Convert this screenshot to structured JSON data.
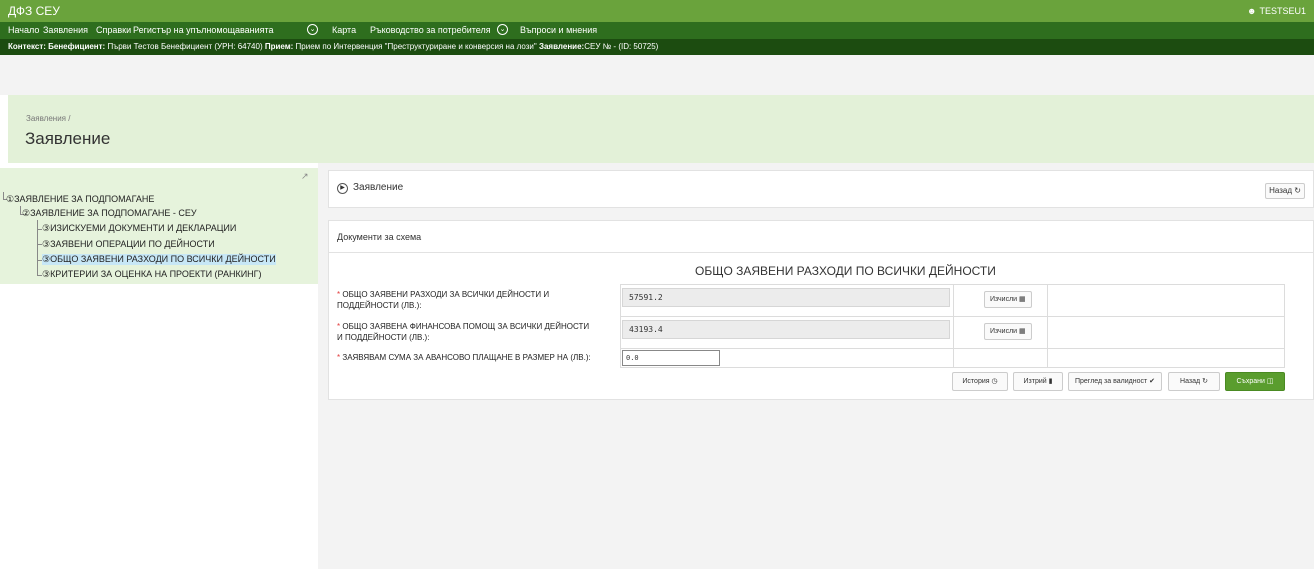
{
  "topbar": {
    "title": "ДФЗ СЕУ",
    "user_icon": "user-icon",
    "user": "TESTSEU1"
  },
  "menu": {
    "items": [
      "Начало",
      "Заявления",
      "Справки",
      "Регистър на упълномощаванията",
      "Карта",
      "Ръководство за потребителя",
      "Въпроси и мнения"
    ],
    "chevron_icon": "chevron-down-icon"
  },
  "context": {
    "label1": "Контекст: Бенефициент:",
    "text1": " Първи Тестов Бенефициент (УРН: 64740) ",
    "label2": "Прием:",
    "text2": " Прием по Интервенция \"Преструктуриране и конверсия на лози\" ",
    "label3": "Заявление:",
    "text3": "СЕУ № - (ID: 50725)"
  },
  "page": {
    "breadcrumb": "Заявления /",
    "title": "Заявление"
  },
  "tree": {
    "expand_icon": "expand-icon",
    "nodes": [
      "①ЗАЯВЛЕНИЕ ЗА ПОДПОМАГАНЕ",
      "②ЗАЯВЛЕНИЕ ЗА ПОДПОМАГАНЕ - СЕУ",
      "③ИЗИСКУЕМИ ДОКУМЕНТИ И ДЕКЛАРАЦИИ",
      "③ЗАЯВЕНИ ОПЕРАЦИИ ПО ДЕЙНОСТИ",
      "③ОБЩО ЗАЯВЕНИ РАЗХОДИ ПО ВСИЧКИ ДЕЙНОСТИ",
      "③КРИТЕРИИ ЗА ОЦЕНКА НА ПРОЕКТИ (РАНКИНГ)"
    ],
    "selected_index": 4
  },
  "panel": {
    "title": "Заявление",
    "back_label": "Назад",
    "play_icon": "play-icon",
    "refresh_icon": "refresh-icon"
  },
  "docs": {
    "label": "Документи за схема",
    "section_title": "ОБЩО ЗАЯВЕНИ РАЗХОДИ ПО ВСИЧКИ ДЕЙНОСТИ",
    "required_mark": "*",
    "rows": [
      {
        "label_line1": "ОБЩО ЗАЯВЕНИ РАЗХОДИ ЗА ВСИЧКИ ДЕЙНОСТИ И",
        "label_line2": "ПОДДЕЙНОСТИ (ЛВ.):",
        "value": "57591.2",
        "button": "Изчисли"
      },
      {
        "label_line1": "ОБЩО ЗАЯВЕНА ФИНАНСОВА ПОМОЩ ЗА ВСИЧКИ ДЕЙНОСТИ",
        "label_line2": "И ПОДДЕЙНОСТИ (ЛВ.):",
        "value": "43193.4",
        "button": "Изчисли"
      },
      {
        "label_line1": "ЗАЯВЯВАМ СУМА ЗА АВАНСОВО ПЛАЩАНЕ В РАЗМЕР НА (ЛВ.):",
        "value": "0.0"
      }
    ],
    "calc_icon": "calculator-icon"
  },
  "actions": {
    "history": "История",
    "delete": "Изтрий",
    "validate": "Преглед за валидност",
    "back": "Назад",
    "save": "Съхрани",
    "history_icon": "clock-icon",
    "delete_icon": "trash-icon",
    "validate_icon": "check-circle-icon",
    "back_icon": "refresh-icon",
    "save_icon": "floppy-icon"
  },
  "colors": {
    "topbar": "#6aa33c",
    "menubar": "#2e6e1e",
    "contextbar": "#1c4c10",
    "save": "#5a9d2e",
    "selected": "#c7e7f6",
    "tree_bg": "#e6f3dc"
  }
}
